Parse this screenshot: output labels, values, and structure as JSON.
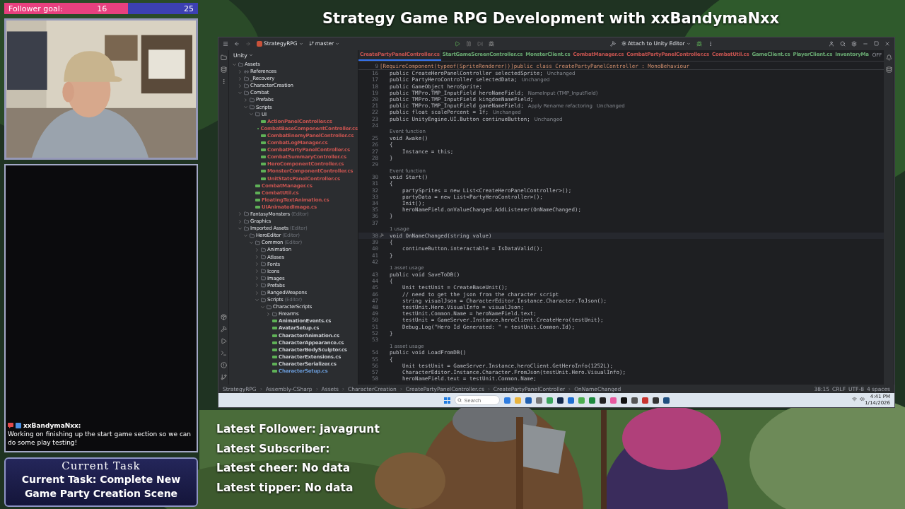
{
  "follower_goal": {
    "label": "Follower goal:",
    "current": "16",
    "target": "25",
    "level": 0.64
  },
  "chat": {
    "user": "xxBandymaNxx:",
    "message": "Working on finishing up the start game section so we can do some play testing!"
  },
  "current_task": {
    "heading": "Current Task",
    "text": "Current Task: Complete New Game Party Creation Scene"
  },
  "stream_title": "Strategy Game RPG Development with xxBandymaNxx",
  "ide": {
    "toolbar": {
      "project": "StrategyRPG",
      "branch": "master",
      "run_config": "Attach to Unity Editor"
    },
    "project_panel": {
      "title": "Unity",
      "tree": [
        {
          "kind": "folder",
          "label": "Assets",
          "expanded": true,
          "children": [
            {
              "kind": "reference",
              "label": "References",
              "expanded": false
            },
            {
              "kind": "folder",
              "label": "_Recovery",
              "expanded": false
            },
            {
              "kind": "folder",
              "label": "CharacterCreation",
              "expanded": false
            },
            {
              "kind": "folder",
              "label": "Combat",
              "expanded": true,
              "children": [
                {
                  "kind": "folder",
                  "label": "Prefabs",
                  "expanded": false
                },
                {
                  "kind": "folder",
                  "label": "Scripts",
                  "expanded": true,
                  "children": [
                    {
                      "kind": "folder",
                      "label": "UI",
                      "expanded": true,
                      "children": [
                        {
                          "kind": "file",
                          "label": "ActionPanelController.cs",
                          "color": "#c75450"
                        },
                        {
                          "kind": "file",
                          "label": "CombatBaseComponentController.cs",
                          "color": "#c75450"
                        },
                        {
                          "kind": "file",
                          "label": "CombatEnemyPanelController.cs",
                          "color": "#c75450"
                        },
                        {
                          "kind": "file",
                          "label": "CombatLogManager.cs",
                          "color": "#c75450"
                        },
                        {
                          "kind": "file",
                          "label": "CombatPartyPanelController.cs",
                          "color": "#c75450"
                        },
                        {
                          "kind": "file",
                          "label": "CombatSummaryController.cs",
                          "color": "#c75450"
                        },
                        {
                          "kind": "file",
                          "label": "HeroComponentController.cs",
                          "color": "#c75450"
                        },
                        {
                          "kind": "file",
                          "label": "MonsterComponentController.cs",
                          "color": "#c75450"
                        },
                        {
                          "kind": "file",
                          "label": "UnitStatsPanelController.cs",
                          "color": "#c75450"
                        }
                      ]
                    },
                    {
                      "kind": "file",
                      "label": "CombatManager.cs",
                      "color": "#c75450"
                    },
                    {
                      "kind": "file",
                      "label": "CombatUtil.cs",
                      "color": "#c75450"
                    },
                    {
                      "kind": "file",
                      "label": "FloatingTextAnimation.cs",
                      "color": "#c75450"
                    },
                    {
                      "kind": "file",
                      "label": "UIAnimatedImage.cs",
                      "color": "#c75450"
                    }
                  ]
                }
              ]
            },
            {
              "kind": "folder",
              "label": "FantasyMonsters",
              "note": "(Editor)",
              "expanded": false
            },
            {
              "kind": "folder",
              "label": "Graphics",
              "expanded": false
            },
            {
              "kind": "folder",
              "label": "Imported Assets",
              "note": "(Editor)",
              "expanded": true,
              "children": [
                {
                  "kind": "folder",
                  "label": "HeroEditor",
                  "note": "(Editor)",
                  "expanded": true,
                  "children": [
                    {
                      "kind": "folder",
                      "label": "Common",
                      "note": "(Editor)",
                      "expanded": true,
                      "children": [
                        {
                          "kind": "folder",
                          "label": "Animation",
                          "expanded": false
                        },
                        {
                          "kind": "folder",
                          "label": "Atlases",
                          "expanded": false
                        },
                        {
                          "kind": "folder",
                          "label": "Fonts",
                          "expanded": false
                        },
                        {
                          "kind": "folder",
                          "label": "Icons",
                          "expanded": false
                        },
                        {
                          "kind": "folder",
                          "label": "Images",
                          "expanded": false
                        },
                        {
                          "kind": "folder",
                          "label": "Prefabs",
                          "expanded": false
                        },
                        {
                          "kind": "folder",
                          "label": "RangedWeapons",
                          "expanded": false
                        },
                        {
                          "kind": "folder",
                          "label": "Scripts",
                          "note": "(Editor)",
                          "expanded": true,
                          "children": [
                            {
                              "kind": "folder",
                              "label": "CharacterScripts",
                              "expanded": true,
                              "children": [
                                {
                                  "kind": "folder",
                                  "label": "Firearms",
                                  "expanded": false
                                },
                                {
                                  "kind": "file",
                                  "label": "AnimationEvents.cs",
                                  "color": "#c9ccd1"
                                },
                                {
                                  "kind": "file",
                                  "label": "AvatarSetup.cs",
                                  "color": "#c9ccd1"
                                },
                                {
                                  "kind": "file",
                                  "label": "CharacterAnimation.cs",
                                  "color": "#c9ccd1"
                                },
                                {
                                  "kind": "file",
                                  "label": "CharacterAppearance.cs",
                                  "color": "#c9ccd1"
                                },
                                {
                                  "kind": "file",
                                  "label": "CharacterBodySculptor.cs",
                                  "color": "#c9ccd1"
                                },
                                {
                                  "kind": "file",
                                  "label": "CharacterExtensions.cs",
                                  "color": "#c9ccd1"
                                },
                                {
                                  "kind": "file",
                                  "label": "CharacterSerializer.cs",
                                  "color": "#c9ccd1"
                                },
                                {
                                  "kind": "file",
                                  "label": "CharacterSetup.cs",
                                  "color": "#6a9bd8"
                                }
                              ]
                            }
                          ]
                        }
                      ]
                    }
                  ]
                }
              ]
            }
          ]
        }
      ]
    },
    "tabs": [
      {
        "label": "CreatePartyPanelController.cs",
        "selected": true,
        "color": "#c75450"
      },
      {
        "label": "StartGameScreenController.cs",
        "selected": false,
        "color": "#6aab73"
      },
      {
        "label": "MonsterClient.cs",
        "selected": false,
        "color": "#6aab73"
      },
      {
        "label": "CombatManager.cs",
        "selected": false,
        "color": "#c75450"
      },
      {
        "label": "CombatPartyPanelController.cs",
        "selected": false,
        "color": "#c75450"
      },
      {
        "label": "CombatUtil.cs",
        "selected": false,
        "color": "#c75450"
      },
      {
        "label": "GameClient.cs",
        "selected": false,
        "color": "#6aab73"
      },
      {
        "label": "PlayerClient.cs",
        "selected": false,
        "color": "#6aab73"
      },
      {
        "label": "InventoryMa",
        "selected": false,
        "color": "#6aab73"
      }
    ],
    "reader_mode": "OFF",
    "code": [
      {
        "kind": "header",
        "number": "9",
        "text": "[RequireComponent(typeof(SpriteRenderer))]public class CreatePartyPanelController : MonoBehaviour"
      },
      {
        "kind": "code",
        "number": "16",
        "text": "public CreateHeroPanelController selectedSprite;",
        "hints": [
          "Unchanged"
        ]
      },
      {
        "kind": "code",
        "number": "17",
        "text": "public PartyHeroController selectedData;",
        "hints": [
          "Unchanged"
        ]
      },
      {
        "kind": "code",
        "number": "18",
        "text": "public GameObject heroSprite;"
      },
      {
        "kind": "code",
        "number": "19",
        "text": "public TMPro.TMP_InputField heroNameField;",
        "hints": [
          "NameInput (TMP_InputField)"
        ]
      },
      {
        "kind": "code",
        "number": "20",
        "text": "public TMPro.TMP_InputField kingdomNameField;"
      },
      {
        "kind": "code",
        "number": "21",
        "text": "public TMPro.TMP_InputField gameNameField;",
        "hints": [
          "Apply Rename refactoring",
          "Unchanged"
        ]
      },
      {
        "kind": "code",
        "number": "22",
        "text": "public float scalePercent = 1f;",
        "hints": [
          "Unchanged"
        ]
      },
      {
        "kind": "code",
        "number": "23",
        "text": "public UnityEngine.UI.Button continueButton;",
        "hints": [
          "Unchanged"
        ]
      },
      {
        "kind": "code",
        "number": "24"
      },
      {
        "kind": "hint",
        "text": "Event function"
      },
      {
        "kind": "code",
        "number": "25",
        "text": "void Awake()"
      },
      {
        "kind": "code",
        "number": "26",
        "text": "{"
      },
      {
        "kind": "code",
        "number": "27",
        "text": "    Instance = this;"
      },
      {
        "kind": "code",
        "number": "28",
        "text": "}"
      },
      {
        "kind": "code",
        "number": "29"
      },
      {
        "kind": "hint",
        "text": "Event function"
      },
      {
        "kind": "code",
        "number": "30",
        "text": "void Start()"
      },
      {
        "kind": "code",
        "number": "31",
        "text": "{"
      },
      {
        "kind": "code",
        "number": "32",
        "text": "    partySprites = new List<CreateHeroPanelController>();"
      },
      {
        "kind": "code",
        "number": "33",
        "text": "    partyData = new List<PartyHeroController>();"
      },
      {
        "kind": "code",
        "number": "34",
        "text": "    Init();"
      },
      {
        "kind": "code",
        "number": "35",
        "text": "    heroNameField.onValueChanged.AddListener(OnNameChanged);"
      },
      {
        "kind": "code",
        "number": "36",
        "text": "}"
      },
      {
        "kind": "code",
        "number": "37"
      },
      {
        "kind": "hint",
        "text": "1 usage"
      },
      {
        "kind": "current",
        "number": "38",
        "text": "void OnNameChanged(string value)"
      },
      {
        "kind": "code",
        "number": "39",
        "text": "{"
      },
      {
        "kind": "code",
        "number": "40",
        "text": "    continueButton.interactable = IsDataValid();"
      },
      {
        "kind": "code",
        "number": "41",
        "text": "}"
      },
      {
        "kind": "code",
        "number": "42"
      },
      {
        "kind": "hint",
        "text": "1 asset usage"
      },
      {
        "kind": "code",
        "number": "43",
        "text": "public void SaveToDB()"
      },
      {
        "kind": "code",
        "number": "44",
        "text": "{"
      },
      {
        "kind": "code",
        "number": "45",
        "text": "    Unit testUnit = CreateBaseUnit();"
      },
      {
        "kind": "code",
        "number": "46",
        "text": "    // need to get the json from the character script"
      },
      {
        "kind": "code",
        "number": "47",
        "text": "    string visualJson = CharacterEditor.Instance.Character.ToJson();"
      },
      {
        "kind": "code",
        "number": "48",
        "text": "    testUnit.Hero.VisualInfo = visualJson;"
      },
      {
        "kind": "code",
        "number": "49",
        "text": "    testUnit.Common.Name = heroNameField.text;"
      },
      {
        "kind": "code",
        "number": "50",
        "text": "    testUnit = GameServer.Instance.heroClient.CreateHero(testUnit);"
      },
      {
        "kind": "code",
        "number": "51",
        "text": "    Debug.Log(\"Hero Id Generated: \" + testUnit.Common.Id);"
      },
      {
        "kind": "code",
        "number": "52",
        "text": "}"
      },
      {
        "kind": "code",
        "number": "53"
      },
      {
        "kind": "hint",
        "text": "1 asset usage"
      },
      {
        "kind": "code",
        "number": "54",
        "text": "public void LoadFromDB()"
      },
      {
        "kind": "code",
        "number": "55",
        "text": "{"
      },
      {
        "kind": "code",
        "number": "56",
        "text": "    Unit testUnit = GameServer.Instance.heroClient.GetHeroInfo(1252L);"
      },
      {
        "kind": "code",
        "number": "57",
        "text": "    CharacterEditor.Instance.Character.FromJson(testUnit.Hero.VisualInfo);"
      },
      {
        "kind": "code",
        "number": "58",
        "text": "    heroNameField.text = testUnit.Common.Name;"
      }
    ],
    "breadcrumbs": [
      "StrategyRPG",
      "Assembly-CSharp",
      "Assets",
      "CharacterCreation",
      "CreatePartyPanelController.cs",
      "CreatePartyPanelController",
      "OnNameChanged"
    ],
    "status": [
      "38:15",
      "CRLF",
      "UTF-8",
      "4 spaces"
    ]
  },
  "taskbar": {
    "search": {
      "placeholder": "Search"
    },
    "time": "4:41 PM",
    "date": "1/14/2026"
  },
  "stream_stats": [
    {
      "label": "Latest Follower:",
      "value": "javagrunt"
    },
    {
      "label": "Latest Subscriber:"
    },
    {
      "label": "Latest cheer:",
      "value": "No data"
    },
    {
      "label": "Latest tipper:",
      "value": "No data"
    }
  ]
}
